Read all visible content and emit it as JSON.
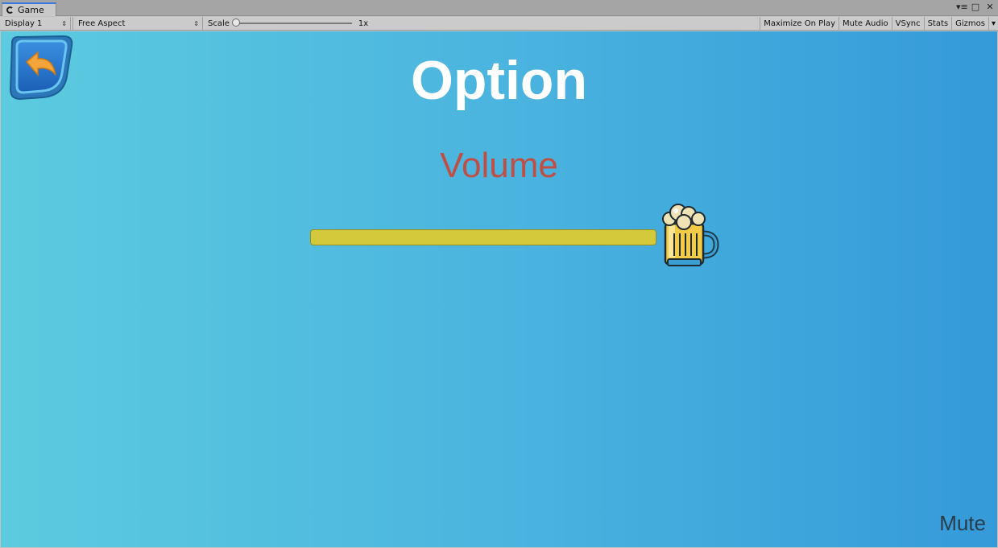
{
  "window": {
    "tab_title": "Game"
  },
  "toolbar": {
    "display": "Display 1",
    "aspect": "Free Aspect",
    "scale_label": "Scale",
    "scale_value": "1x",
    "maximize_on_play": "Maximize On Play",
    "mute_audio": "Mute Audio",
    "vsync": "VSync",
    "stats": "Stats",
    "gizmos": "Gizmos"
  },
  "game": {
    "title": "Option",
    "volume_label": "Volume",
    "volume_level": 1.0,
    "mute_label": "Mute",
    "colors": {
      "title": "#ffffff",
      "volume_label": "#c04f43",
      "slider_fill": "#d4c93a",
      "mute": "#2a3b4a"
    },
    "icons": {
      "back": "back-arrow-icon",
      "handle": "beer-mug-icon"
    }
  }
}
